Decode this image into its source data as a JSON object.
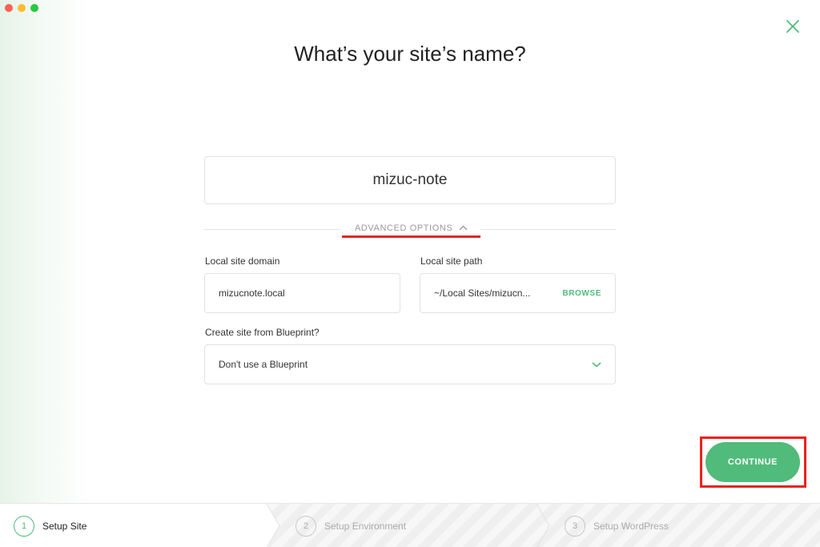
{
  "wizard": {
    "title": "What’s your site’s name?",
    "site_name_value": "mizuc-note",
    "advanced_options_label": "ADVANCED OPTIONS",
    "domain": {
      "label": "Local site domain",
      "value": "mizucnote.local"
    },
    "path": {
      "label": "Local site path",
      "value": "~/Local Sites/mizucn...",
      "browse_label": "BROWSE"
    },
    "blueprint": {
      "label": "Create site from Blueprint?",
      "selected": "Don't use a Blueprint"
    },
    "continue_label": "CONTINUE"
  },
  "steps": [
    {
      "number": "1",
      "label": "Setup Site",
      "state": "active"
    },
    {
      "number": "2",
      "label": "Setup Environment",
      "state": "inactive"
    },
    {
      "number": "3",
      "label": "Setup WordPress",
      "state": "inactive"
    }
  ],
  "colors": {
    "accent": "#51bb7b",
    "annotation_red": "#e8231c"
  },
  "icons": {
    "close": "close-icon",
    "advanced_toggle": "chevron-up-icon",
    "select": "chevron-down-icon"
  }
}
